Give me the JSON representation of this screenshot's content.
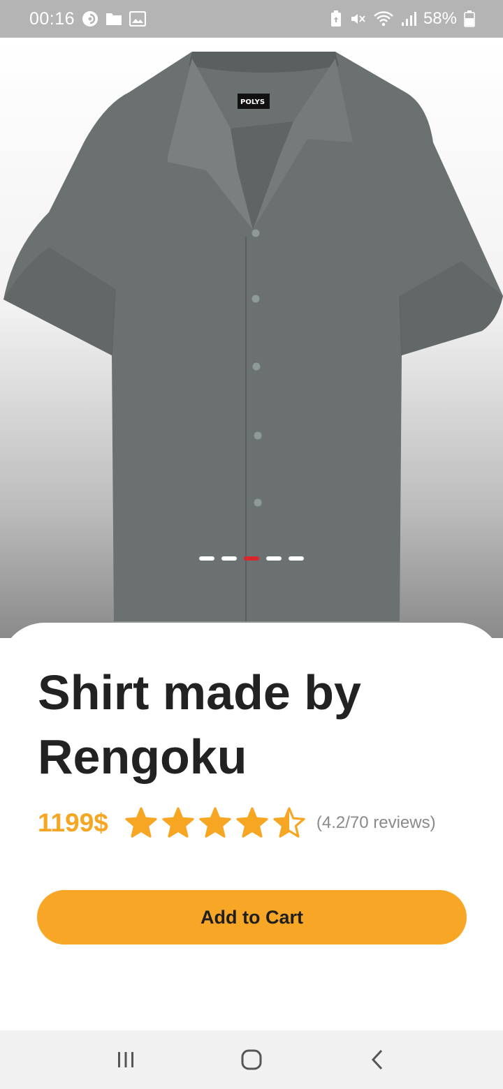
{
  "status_bar": {
    "time": "00:16",
    "battery_percent": "58%",
    "left_icons": [
      "pocket-cast-icon",
      "folder-icon",
      "gallery-icon"
    ],
    "right_icons": [
      "battery-saver-icon",
      "mute-icon",
      "wifi-icon",
      "signal-icon",
      "battery-icon"
    ]
  },
  "product": {
    "image_icon": "shirt-image",
    "carousel": {
      "count": 5,
      "active_index": 2
    },
    "title": "Shirt made by Rengoku",
    "price": "1199$",
    "rating": 4.2,
    "rating_max": 5,
    "reviews_text": "(4.2/70 reviews)",
    "add_to_cart_label": "Add to Cart"
  },
  "colors": {
    "accent": "#f7a626",
    "star": "#f6a623",
    "carousel_active": "#d8262b",
    "title": "#222222",
    "status_bar": "#b4b4b4",
    "shirt": "#6b7170"
  },
  "nav_bar": {
    "items": [
      "recent-apps-icon",
      "home-icon",
      "back-icon"
    ]
  }
}
